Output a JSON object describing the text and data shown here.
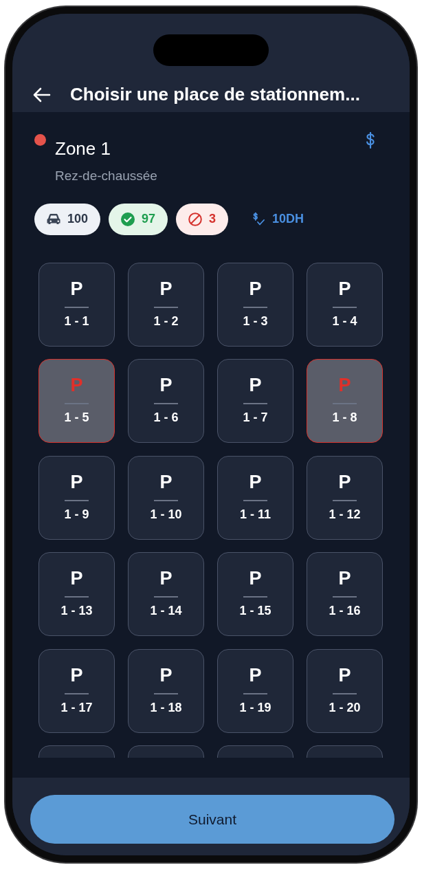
{
  "header": {
    "title": "Choisir une place de stationnem..."
  },
  "zone": {
    "name": "Zone 1",
    "color": "#e5534b",
    "floor": "Rez-de-chaussée"
  },
  "stats": [
    {
      "kind": "total",
      "value": "100"
    },
    {
      "kind": "free",
      "value": "97"
    },
    {
      "kind": "occupied",
      "value": "3"
    },
    {
      "kind": "price",
      "value": "10DH"
    }
  ],
  "spots": [
    {
      "label": "P",
      "number": "1 - 1",
      "occupied": false
    },
    {
      "label": "P",
      "number": "1 - 2",
      "occupied": false
    },
    {
      "label": "P",
      "number": "1 - 3",
      "occupied": false
    },
    {
      "label": "P",
      "number": "1 - 4",
      "occupied": false
    },
    {
      "label": "P",
      "number": "1 - 5",
      "occupied": true
    },
    {
      "label": "P",
      "number": "1 - 6",
      "occupied": false
    },
    {
      "label": "P",
      "number": "1 - 7",
      "occupied": false
    },
    {
      "label": "P",
      "number": "1 - 8",
      "occupied": true
    },
    {
      "label": "P",
      "number": "1 - 9",
      "occupied": false
    },
    {
      "label": "P",
      "number": "1 - 10",
      "occupied": false
    },
    {
      "label": "P",
      "number": "1 - 11",
      "occupied": false
    },
    {
      "label": "P",
      "number": "1 - 12",
      "occupied": false
    },
    {
      "label": "P",
      "number": "1 - 13",
      "occupied": false
    },
    {
      "label": "P",
      "number": "1 - 14",
      "occupied": false
    },
    {
      "label": "P",
      "number": "1 - 15",
      "occupied": false
    },
    {
      "label": "P",
      "number": "1 - 16",
      "occupied": false
    },
    {
      "label": "P",
      "number": "1 - 17",
      "occupied": false
    },
    {
      "label": "P",
      "number": "1 - 18",
      "occupied": false
    },
    {
      "label": "P",
      "number": "1 - 19",
      "occupied": false
    },
    {
      "label": "P",
      "number": "1 - 20",
      "occupied": false
    }
  ],
  "footer": {
    "button": "Suivant"
  }
}
